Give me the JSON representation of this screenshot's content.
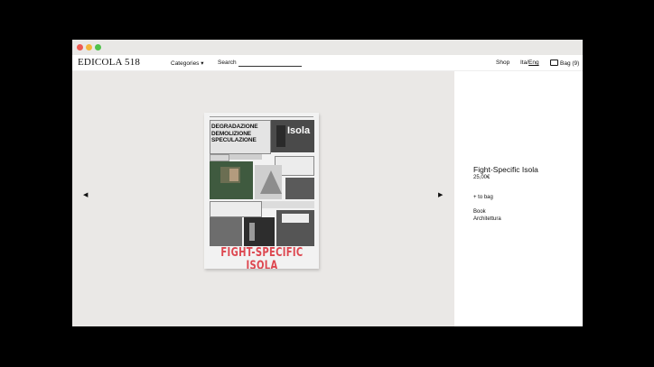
{
  "window": {
    "controls": [
      "close",
      "minimize",
      "maximize"
    ]
  },
  "header": {
    "logo": "EDICOLA 518",
    "categories_label": "Categories ▾",
    "search_label": "Search",
    "search_value": "",
    "shop_label": "Shop",
    "lang_ita": "Ita",
    "lang_sep": "/",
    "lang_eng": "Eng",
    "bag_label": "Bag (9)"
  },
  "gallery": {
    "prev_icon": "◀",
    "next_icon": "▶",
    "cover_title": "FIGHT-SPECIFIC ISOLA",
    "cover_headline": "DEGRADAZIONE DEMOLIZIONE SPECULAZIONE",
    "cover_word": "Isola",
    "accent_color": "#dd4750"
  },
  "product": {
    "title": "Fight-Specific Isola",
    "price": "25,00€",
    "add_to_bag": "+ to bag",
    "type": "Book",
    "category": "Architettura"
  }
}
